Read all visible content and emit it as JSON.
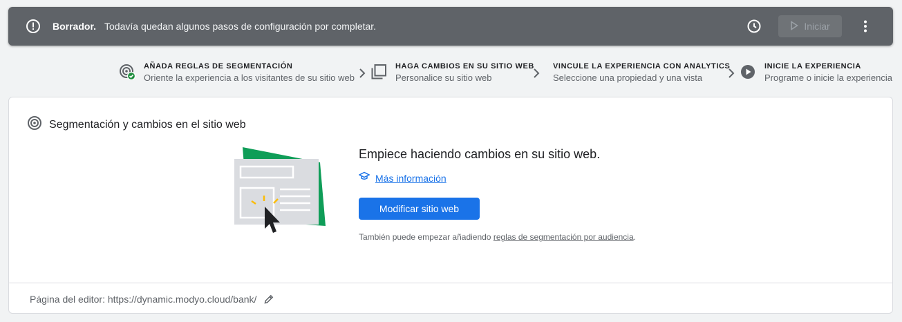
{
  "banner": {
    "status_label": "Borrador.",
    "message": "Todavía quedan algunos pasos de configuración por completar.",
    "start_label": "Iniciar",
    "icons": {
      "alert": "alert-circle-icon",
      "history": "history-clock-icon",
      "more": "more-vert-icon",
      "play": "play-icon"
    }
  },
  "steps": [
    {
      "title": "AÑADA REGLAS DE SEGMENTACIÓN",
      "subtitle": "Oriente la experiencia a los visitantes de su sitio web",
      "icon": "target-check-icon",
      "status_color": "#1e8e3e"
    },
    {
      "title": "HAGA CAMBIOS EN SU SITIO WEB",
      "subtitle": "Personalice su sitio web",
      "icon": "pages-icon"
    },
    {
      "title": "VINCULE LA EXPERIENCIA CON ANALYTICS",
      "subtitle": "Seleccione una propiedad y una vista",
      "icon": ""
    },
    {
      "title": "INICIE LA EXPERIENCIA",
      "subtitle": "Programe o inicie la experiencia",
      "icon": "play-circle-icon"
    }
  ],
  "card": {
    "title": "Segmentación y cambios en el sitio web",
    "headline": "Empiece haciendo cambios en su sitio web.",
    "learn_more": "Más información",
    "primary_button": "Modificar sitio web",
    "hint_prefix": "También puede empezar añadiendo",
    "hint_link": "reglas de segmentación por audiencia",
    "hint_suffix": ".",
    "editor_page": "Página del editor: https://dynamic.modyo.cloud/bank/"
  },
  "colors": {
    "accent": "#1a73e8",
    "banner": "#5f6368",
    "success": "#1e8e3e",
    "illustration_green": "#0f9d58",
    "spark": "#fbbc04"
  }
}
